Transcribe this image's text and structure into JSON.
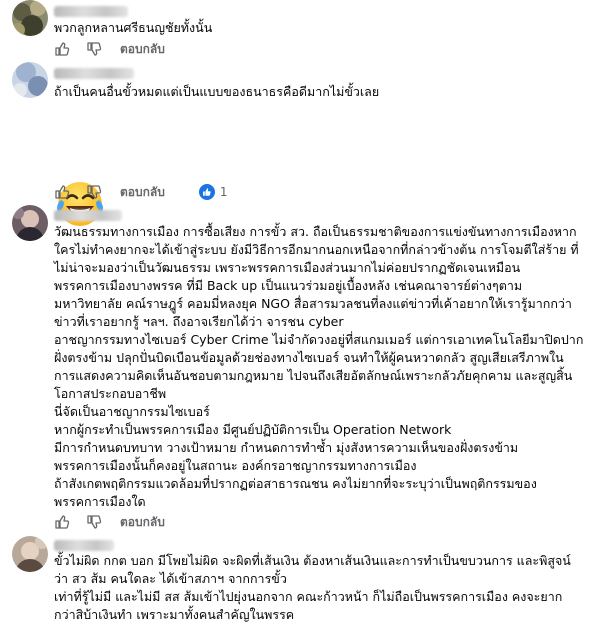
{
  "comments": [
    {
      "lines": [
        "พวกลูกหลานศรีธนญชัยทั้งนั้น"
      ],
      "reply_label": "ตอบกลับ"
    },
    {
      "lines": [
        "ถ้าเป็นคนอื่นขั้วหมดแต่เป็นแบบของธนาธรคือดีมากไม่ขั้วเลย"
      ],
      "emoji": "laughing-tears-emoji",
      "reply_label": "ตอบกลับ",
      "reaction_count": "1"
    },
    {
      "lines": [
        "วัฒนธรรมทางการเมือง การซื้อเสียง การขั้ว สว. ถือเป็นธรรมชาติของการแข่งขันทางการเมืองหาก",
        "ใครไม่ทำคงยากจะได้เข้าสู่ระบบ ยังมีวิธีการอีกมากนอกเหนือจากที่กล่าวข้างต้น การโจมตีใส่ร้าย ที่",
        "ไม่น่าจะมองว่าเป็นวัฒนธรรม เพราะพรรคการเมืองส่วนมากไม่ค่อยปรากฏชัดเจนเหมือน",
        "พรรคการเมืองบางพรรค ที่มี Back up เป็นแนวร่วมอยู่เบื้องหลัง เช่นคณาจารย์ต่างๆตาม",
        "มหาวิทยาลัย คณ์ราษฎูร์ คอมมี่หลงยุค NGO สื่อสารมวลชนที่ลงแต่ข่าวที่เค้าอยากให้เรารู้มากกว่า",
        "ข่าวที่เราอยากรู้ ฯลฯ. ถึงอาจเรียกได้ว่า จารชน cyber",
        "อาชญากรรมทางไซเบอร์ Cyber Crime ไม่จำกัดวงอยู่ที่สแกมเมอร์ แต่การเอาเทคโนโลยีมาปิดปาก",
        "ฝั่งตรงข้าม ปลุกปั่นบิดเบือนข้อมูลด้วยช่องทางไซเบอร์ จนทำให้ผู้คนหวาดกลัว สูญเสียเสรีภาพใน",
        "การแสดงความคิดเห็นอันชอบตามกฎหมาย ไปจนถึงเสียอัตลักษณ์เพราะกลัวภัยคุกคาม และสูญสิ้น",
        "โอกาสประกอบอาชีพ",
        "นี่จัดเป็นอาชญากรรมไซเบอร์",
        "หากผู้กระทำเป็นพรรคการเมือง มีศูนย์ปฏิบัติการเป็น Operation Network",
        "มีการกำหนดบทบาท วางเป้าหมาย กำหนดการทำซ้ำ มุ่งสังหารความเห็นของฝั่งตรงข้าม",
        "พรรคการเมืองนั้นก็คงอยู่ในสถานะ องค์กรอาชญากรรมทางการเมือง",
        "ถ้าสังเกตพฤติกรรมแวดล้อมที่ปรากฏต่อสาธารณชน คงไม่ยากที่จะระบุว่าเป็นพฤติกรรมของ",
        "พรรคการเมืองใด"
      ],
      "reply_label": "ตอบกลับ"
    },
    {
      "lines": [
        "ขั้วไม่ผิด กกต บอก มีโพยไม่ผิด จะผิดที่เส้นเงิน ต้องหาเส้นเงินและการทำเป็นขบวนการ และพิสูจน์",
        "ว่า สว ส้ม คนใดละ ได้เข้าสภาฯ จากการขั้ว",
        "เท่าที่รู้ไม่มี และไม่มี สส ส้มเข้าไปยุ่งนอกจาก คณะก้าวหน้า ก็ไม่ถือเป็นพรรคการเมือง คงจะยาก",
        "กว่าสิบ้าเงินทำ เพราะมาทั้งคนสำคัญในพรรค"
      ]
    }
  ],
  "icons": {
    "like": "thumbs-up-icon",
    "dislike": "thumbs-down-icon",
    "reaction": "like-reaction-icon"
  },
  "colors": {
    "reaction_blue": "#1b74e4",
    "secondary_text": "#65676b"
  }
}
